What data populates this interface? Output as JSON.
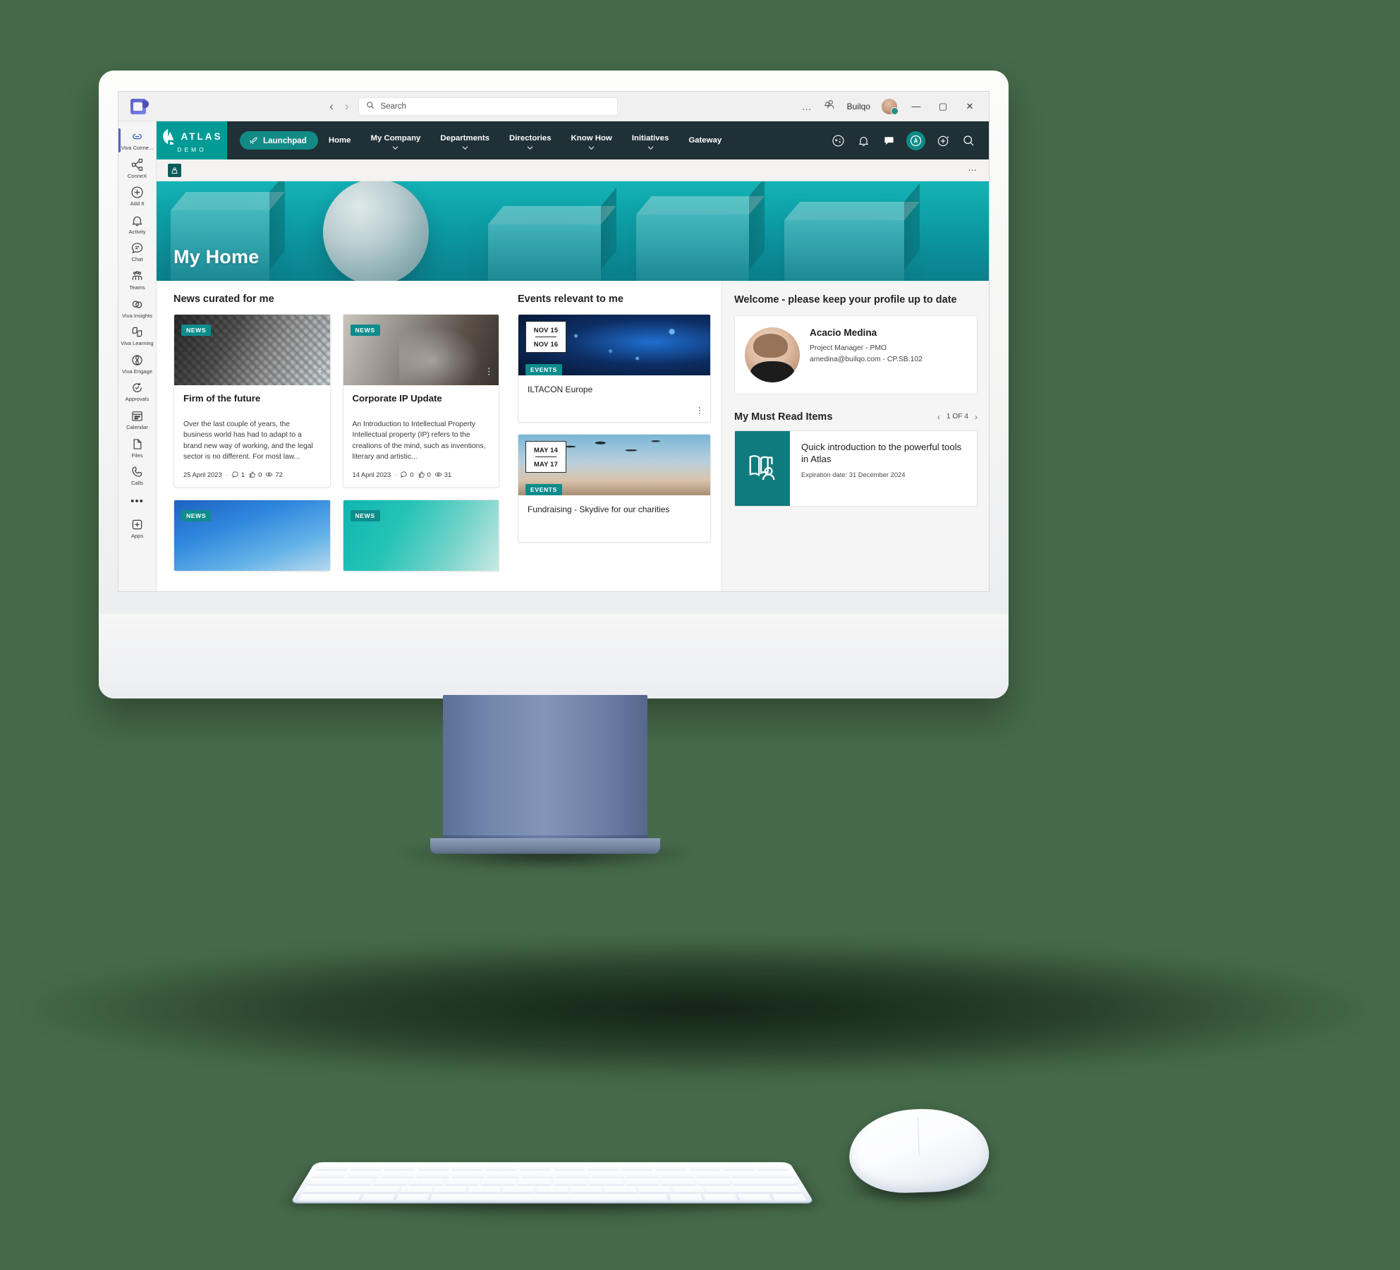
{
  "titlebar": {
    "app_icon": "teams-icon",
    "back_label": "‹",
    "forward_label": "›",
    "search_placeholder": "Search",
    "overflow_label": "…",
    "user_name": "Builqo",
    "minimize_label": "—",
    "maximize_label": "▢",
    "close_label": "✕"
  },
  "rail": {
    "items": [
      {
        "label": "Viva Conne...",
        "icon": "viva-connections-icon",
        "active": true
      },
      {
        "label": "ConneX",
        "icon": "share-network-icon",
        "active": false
      },
      {
        "label": "Add It",
        "icon": "plus-circle-icon",
        "active": false
      },
      {
        "label": "Activity",
        "icon": "bell-icon",
        "active": false
      },
      {
        "label": "Chat",
        "icon": "chat-bubble-icon",
        "active": false
      },
      {
        "label": "Teams",
        "icon": "teams-people-icon",
        "active": false
      },
      {
        "label": "Viva Insights",
        "icon": "viva-insights-icon",
        "active": false
      },
      {
        "label": "Viva Learning",
        "icon": "viva-learning-icon",
        "active": false
      },
      {
        "label": "Viva Engage",
        "icon": "viva-engage-icon",
        "active": false
      },
      {
        "label": "Approvals",
        "icon": "approvals-check-icon",
        "active": false
      },
      {
        "label": "Calendar",
        "icon": "calendar-icon",
        "active": false
      },
      {
        "label": "Files",
        "icon": "file-icon",
        "active": false
      },
      {
        "label": "Calls",
        "icon": "phone-icon",
        "active": false
      }
    ],
    "more_label": "•••",
    "apps_label": "Apps"
  },
  "atlas": {
    "brand_name": "ATLAS",
    "brand_sub": "DEMO",
    "launchpad_label": "Launchpad",
    "nav": [
      {
        "label": "Home",
        "has_caret": false
      },
      {
        "label": "My Company",
        "has_caret": true
      },
      {
        "label": "Departments",
        "has_caret": true
      },
      {
        "label": "Directories",
        "has_caret": true
      },
      {
        "label": "Know How",
        "has_caret": true
      },
      {
        "label": "Initiatives",
        "has_caret": true
      },
      {
        "label": "Gateway",
        "has_caret": false
      }
    ],
    "icons": [
      {
        "name": "sparkle-circle-icon"
      },
      {
        "name": "bell-icon"
      },
      {
        "name": "comment-icon"
      },
      {
        "name": "atlas-assistant-icon"
      },
      {
        "name": "add-circle-icon"
      },
      {
        "name": "search-icon"
      }
    ],
    "accent_color": "#009b95",
    "bar_color": "#1f3036"
  },
  "commandbar": {
    "site_icon": "site-logo-icon",
    "overflow_label": "⋯"
  },
  "hero": {
    "title": "My Home"
  },
  "news": {
    "section_title": "News curated for me",
    "cards": [
      {
        "tag": "NEWS",
        "title": "Firm of the future",
        "description": "Over the last couple of years, the business world has had to adapt to a brand new way of working, and the legal sector is no different. For most law...",
        "date": "25 April 2023",
        "comments": "1",
        "likes": "0",
        "views": "72"
      },
      {
        "tag": "NEWS",
        "title": "Corporate IP Update",
        "description": "An Introduction to Intellectual Property Intellectual property (IP) refers to the creations of the mind, such as inventions, literary and artistic...",
        "date": "14 April 2023",
        "comments": "0",
        "likes": "0",
        "views": "31"
      },
      {
        "tag": "NEWS",
        "title": "",
        "description": "",
        "date": "",
        "comments": "",
        "likes": "",
        "views": ""
      },
      {
        "tag": "NEWS",
        "title": "",
        "description": "",
        "date": "",
        "comments": "",
        "likes": "",
        "views": ""
      }
    ]
  },
  "events": {
    "section_title": "Events relevant to me",
    "cards": [
      {
        "tag": "EVENTS",
        "start": "NOV 15",
        "end": "NOV 16",
        "title": "ILTACON Europe"
      },
      {
        "tag": "EVENTS",
        "start": "MAY 14",
        "end": "MAY 17",
        "title": "Fundraising - Skydive for our charities"
      }
    ]
  },
  "right_panel": {
    "welcome_title": "Welcome - please keep your profile up to date",
    "profile": {
      "name": "Acacio Medina",
      "role": "Project Manager - PMO",
      "contact": "amedina@builqo.com - CP.SB.102"
    },
    "must_read": {
      "title": "My Must Read Items",
      "pager": "1 OF 4",
      "prev_label": "‹",
      "next_label": "›",
      "item_title": "Quick introduction to the powerful tools in Atlas",
      "item_expiry": "Expiration date: 31 December 2024",
      "thumb_icon": "book-person-icon",
      "thumb_color": "#0f7b7e"
    }
  }
}
